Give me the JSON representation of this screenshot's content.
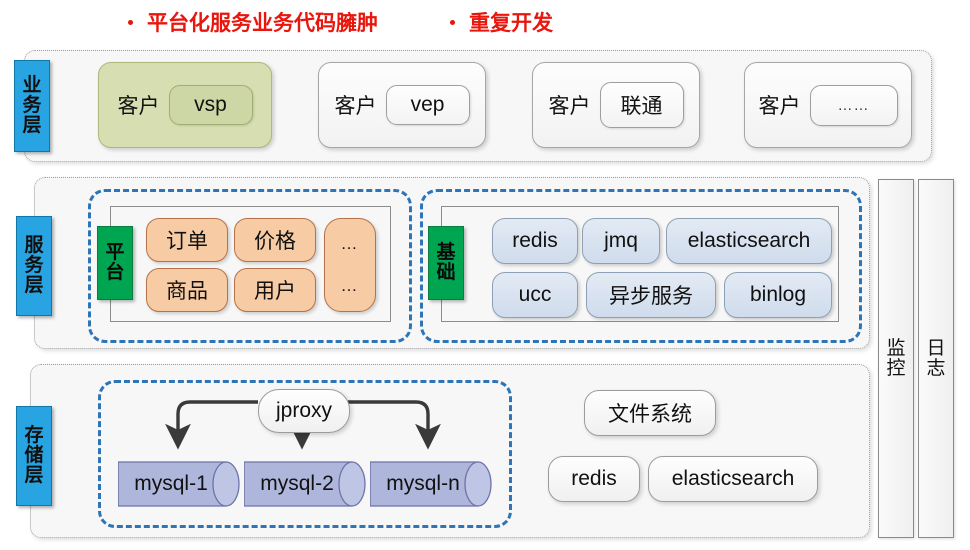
{
  "header": {
    "bullets": [
      {
        "text": "平台化服务业务代码臃肿"
      },
      {
        "text": "重复开发"
      }
    ],
    "color": "#E8160C"
  },
  "colors": {
    "layer_tab_blue": "#28A4E2",
    "module_tab_green": "#00A551",
    "dashed_group_blue": "#2E75B6",
    "highlight_olive": "#D7DEB2",
    "pill_peach": "#F7CBA4",
    "pill_blue": "#DCE6F1",
    "db_cylinder": "#AFB6DC",
    "panel_bg": "#F7F7F7"
  },
  "layers": [
    {
      "id": "business",
      "tab": {
        "label": "业务层",
        "chars": [
          "业",
          "务",
          "层"
        ]
      },
      "clients": [
        {
          "label": "客户",
          "name": "vsp",
          "highlight": true
        },
        {
          "label": "客户",
          "name": "vep",
          "highlight": false
        },
        {
          "label": "客户",
          "name": "联通",
          "highlight": false
        },
        {
          "label": "客户",
          "name": "……",
          "highlight": false
        }
      ]
    },
    {
      "id": "service",
      "tab": {
        "label": "服务层",
        "chars": [
          "服",
          "务",
          "层"
        ]
      },
      "groups": [
        {
          "id": "platform",
          "tab": {
            "label": "平台",
            "chars": [
              "平",
              "台"
            ]
          },
          "pills": [
            {
              "text": "订单",
              "style": "peach"
            },
            {
              "text": "价格",
              "style": "peach"
            },
            {
              "text": "商品",
              "style": "peach"
            },
            {
              "text": "用户",
              "style": "peach"
            }
          ],
          "more_pill": {
            "rows": [
              "…",
              "…"
            ],
            "style": "peach"
          }
        },
        {
          "id": "infrastructure",
          "tab": {
            "label": "基础",
            "chars": [
              "基",
              "础"
            ]
          },
          "pills": [
            {
              "text": "redis",
              "style": "blue"
            },
            {
              "text": "jmq",
              "style": "blue"
            },
            {
              "text": "elasticsearch",
              "style": "blue"
            },
            {
              "text": "ucc",
              "style": "blue"
            },
            {
              "text": "异步服务",
              "style": "blue"
            },
            {
              "text": "binlog",
              "style": "blue"
            }
          ]
        }
      ]
    },
    {
      "id": "storage",
      "tab": {
        "label": "存储层",
        "chars": [
          "存",
          "储",
          "层"
        ]
      },
      "proxy": {
        "label": "jproxy"
      },
      "databases": [
        {
          "label": "mysql-1"
        },
        {
          "label": "mysql-2"
        },
        {
          "label": "mysql-n"
        }
      ],
      "others": [
        {
          "text": "文件系统"
        },
        {
          "text": "redis"
        },
        {
          "text": "elasticsearch"
        }
      ]
    }
  ],
  "side_columns": [
    {
      "id": "monitoring",
      "label": "监控",
      "chars": [
        "监",
        "控"
      ]
    },
    {
      "id": "logging",
      "label": "日志",
      "chars": [
        "日",
        "志"
      ]
    }
  ]
}
